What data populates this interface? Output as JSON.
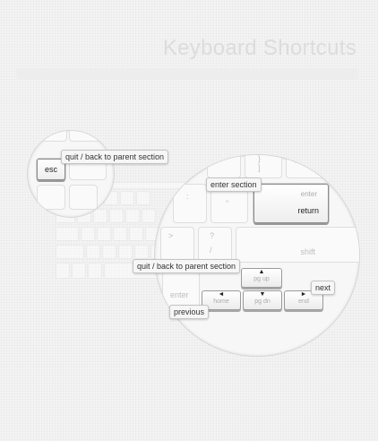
{
  "page_title": "Keyboard Shortcuts",
  "keys": {
    "esc": "esc",
    "return": "return",
    "enter_legend": "enter",
    "shift": "shift",
    "enter_numpad": "enter",
    "pg_up_arrow": "▲",
    "pg_up": "pg up",
    "home_arrow": "◄",
    "home": "home",
    "pg_dn_arrow": "▼",
    "pg_dn": "pg dn",
    "end_arrow": "►",
    "end": "end",
    "question": "?",
    "slash": "/",
    "greater": ">",
    "colon": ":",
    "quote": "\"",
    "brace": "}",
    "bracket": "]",
    "pipe": "\\"
  },
  "tooltips": {
    "esc_tip": "quit / back to parent section",
    "return_tip": "enter section",
    "arrows_tip": "quit / back to parent section",
    "next_tip": "next",
    "previous_tip": "previous"
  }
}
